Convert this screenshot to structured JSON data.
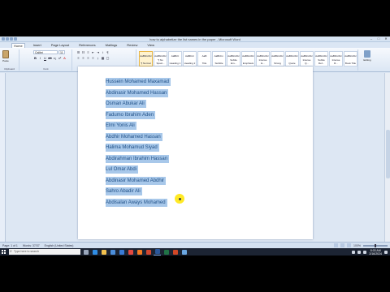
{
  "window": {
    "title": "how to alphabetize the list names in the paper - Microsoft Word",
    "controls": [
      "–",
      "□",
      "✕"
    ]
  },
  "ribbon_tabs": [
    "Home",
    "Insert",
    "Page Layout",
    "References",
    "Mailings",
    "Review",
    "View"
  ],
  "ribbon": {
    "paste_label": "Paste",
    "clipboard_label": "Clipboard",
    "font_name": "Calibri",
    "font_size": "11",
    "font_group_label": "Font",
    "paragraph_group_label": "Paragraph",
    "styles_group_label": "Styles",
    "editing_label": "Editing",
    "styles": [
      {
        "sample": "AaBbCcDc",
        "name": "¶ Normal"
      },
      {
        "sample": "AaBbCcDc",
        "name": "¶ No Spaci..."
      },
      {
        "sample": "AaBbC",
        "name": "Heading 1"
      },
      {
        "sample": "AaBbCc",
        "name": "Heading 2"
      },
      {
        "sample": "AaB",
        "name": "Title"
      },
      {
        "sample": "AaBbCc.",
        "name": "Subtitle"
      },
      {
        "sample": "AaBbCcDc",
        "name": "Subtle Em..."
      },
      {
        "sample": "AaBbCcDc",
        "name": "Emphasis"
      },
      {
        "sample": "AaBbCcDc",
        "name": "Intense E..."
      },
      {
        "sample": "AaBbCcDc",
        "name": "Strong"
      },
      {
        "sample": "AaBbCcDc",
        "name": "Quote"
      },
      {
        "sample": "AaBbCcDc",
        "name": "Intense Q..."
      },
      {
        "sample": "AaBbCcDc",
        "name": "Subtle Ref..."
      },
      {
        "sample": "AaBbCcDc",
        "name": "Intense R..."
      },
      {
        "sample": "AaBbCcDc",
        "name": "Book Title"
      }
    ]
  },
  "document": {
    "names": [
      "Hussein Mohamed Maxamad",
      "Abdinasir Mohamed Hassan",
      "Osman Abukar Ali",
      "Fadumo Ibrahim Aden",
      "Elmi Yonis Ali",
      "Abdhir Mohamed Hassan",
      "Halima Mohamud Siyad",
      "Abdirahman Ibrahim Hassan",
      "Lul Omar Abdi",
      "Abdinasir Mohamed Abdhir",
      "Sahro Abadir Ali",
      "Abdisalan Aways Mohamed"
    ]
  },
  "statusbar": {
    "page": "Page: 1 of 1",
    "words": "Words: 37/37",
    "language": "English (United States)",
    "zoom": "100%"
  },
  "taskbar": {
    "search_placeholder": "Type here to search",
    "icons": [
      {
        "name": "task-view-icon",
        "color": "#9aa7bb"
      },
      {
        "name": "edge-icon",
        "color": "#2f8de4"
      },
      {
        "name": "file-explorer-icon",
        "color": "#f2c14e"
      },
      {
        "name": "store-icon",
        "color": "#4c8fdc"
      },
      {
        "name": "mail-icon",
        "color": "#3a7bd5"
      },
      {
        "name": "chrome-icon",
        "color": "#e4483f"
      },
      {
        "name": "firefox-icon",
        "color": "#f47a20"
      },
      {
        "name": "recorder-icon",
        "color": "#d1462f"
      },
      {
        "name": "word-icon",
        "color": "#2b579a"
      },
      {
        "name": "excel-icon",
        "color": "#217346"
      },
      {
        "name": "powerpoint-icon",
        "color": "#d24726"
      },
      {
        "name": "photos-icon",
        "color": "#6aa6e0"
      }
    ],
    "time": "8:03 AM",
    "date": "2/16/2024"
  }
}
